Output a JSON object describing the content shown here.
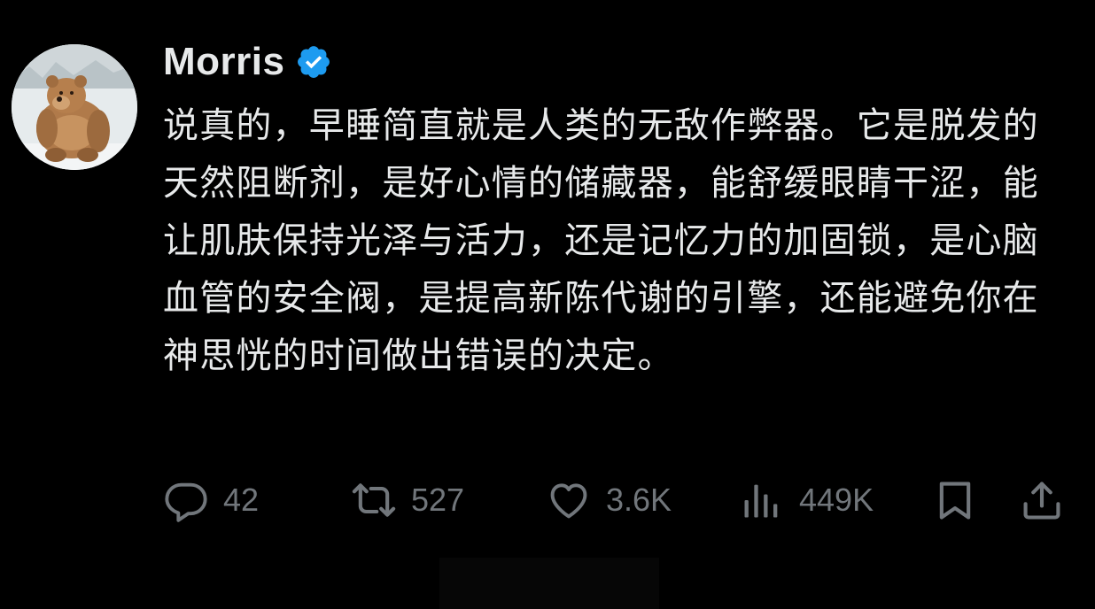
{
  "author": {
    "display_name": "Morris",
    "verified": true,
    "avatar": "bear-avatar"
  },
  "tweet": {
    "text": "说真的，早睡简直就是人类的无敌作弊器。它是脱发的天然阻断剂，是好心情的储藏器，能舒缓眼睛干涩，能让肌肤保持光泽与活力，还是记忆力的加固锁，是心脑血管的安全阀，是提高新陈代谢的引擎，还能避免你在神思恍的时间做出错误的决定。"
  },
  "actions": {
    "reply": {
      "icon": "reply-icon",
      "count": "42"
    },
    "retweet": {
      "icon": "retweet-icon",
      "count": "527"
    },
    "like": {
      "icon": "heart-icon",
      "count": "3.6K"
    },
    "views": {
      "icon": "views-icon",
      "count": "449K"
    },
    "bookmark": {
      "icon": "bookmark-icon"
    },
    "share": {
      "icon": "share-icon"
    }
  },
  "colors": {
    "background": "#000000",
    "text": "#e7e9ea",
    "secondary": "#71767b",
    "verified": "#1d9bf0"
  }
}
